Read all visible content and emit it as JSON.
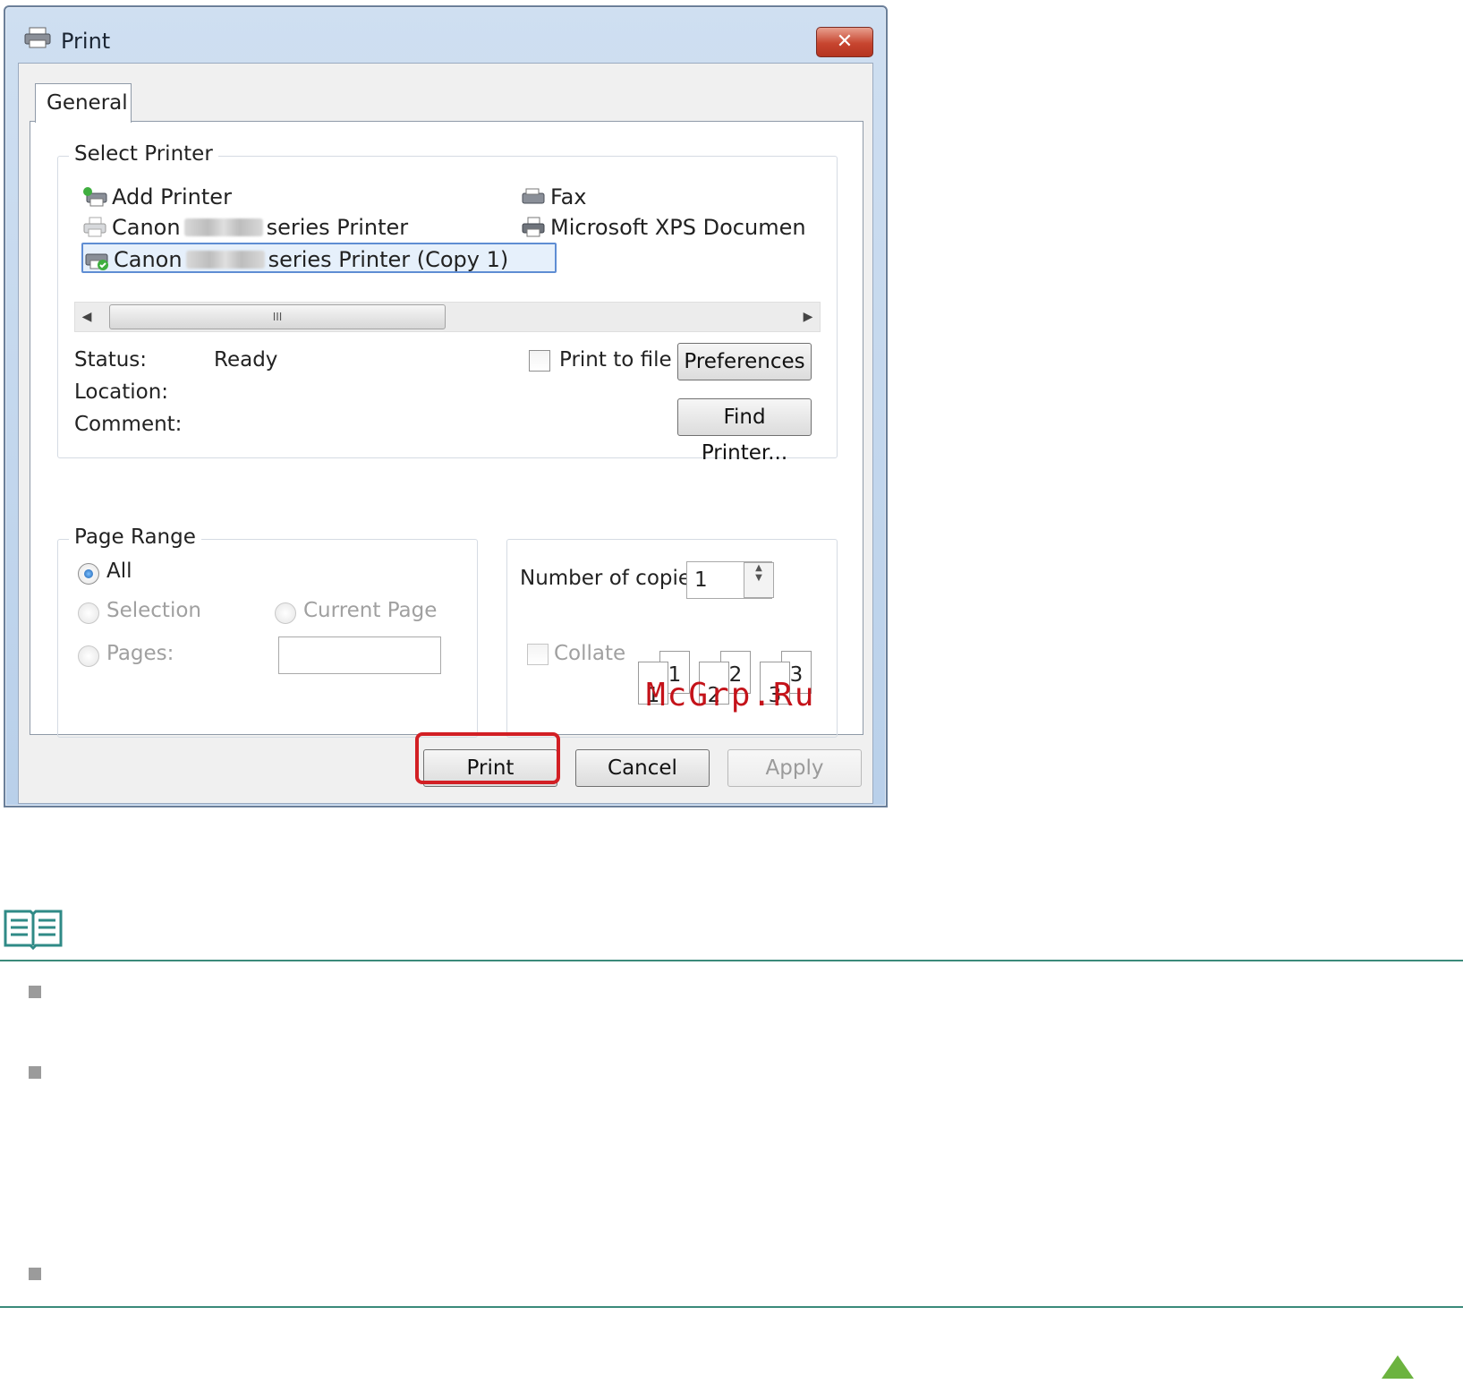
{
  "window": {
    "title": "Print",
    "close_label": "✕"
  },
  "tabs": [
    {
      "label": "General"
    }
  ],
  "select_printer": {
    "group_title": "Select Printer",
    "printers": [
      {
        "label": "Add Printer",
        "icon": "add-printer-icon"
      },
      {
        "label_prefix": "Canon",
        "label_suffix": "series Printer",
        "icon": "printer-icon"
      },
      {
        "label_prefix": "Canon",
        "label_suffix": "series Printer (Copy 1)",
        "icon": "default-printer-icon",
        "selected": true
      },
      {
        "label": "Fax",
        "icon": "fax-icon"
      },
      {
        "label": "Microsoft XPS Documen",
        "icon": "printer-icon"
      }
    ],
    "scroll_grip": "III",
    "status_label": "Status:",
    "status_value": "Ready",
    "location_label": "Location:",
    "comment_label": "Comment:",
    "print_to_file_label": "Print to file",
    "preferences_label": "Preferences",
    "find_printer_label": "Find Printer..."
  },
  "page_range": {
    "group_title": "Page Range",
    "all_label": "All",
    "selection_label": "Selection",
    "current_page_label": "Current Page",
    "pages_label": "Pages:",
    "pages_value": ""
  },
  "copies": {
    "number_label": "Number of copies:",
    "number_value": "1",
    "collate_label": "Collate",
    "collate_pages": [
      "1",
      "1",
      "2",
      "2",
      "3",
      "3"
    ]
  },
  "buttons": {
    "print": "Print",
    "cancel": "Cancel",
    "apply": "Apply"
  },
  "watermark": "McGrp.Ru",
  "colors": {
    "highlight": "#d21f24",
    "rule": "#3b8a7a",
    "accent_arrow": "#6cb33f"
  }
}
